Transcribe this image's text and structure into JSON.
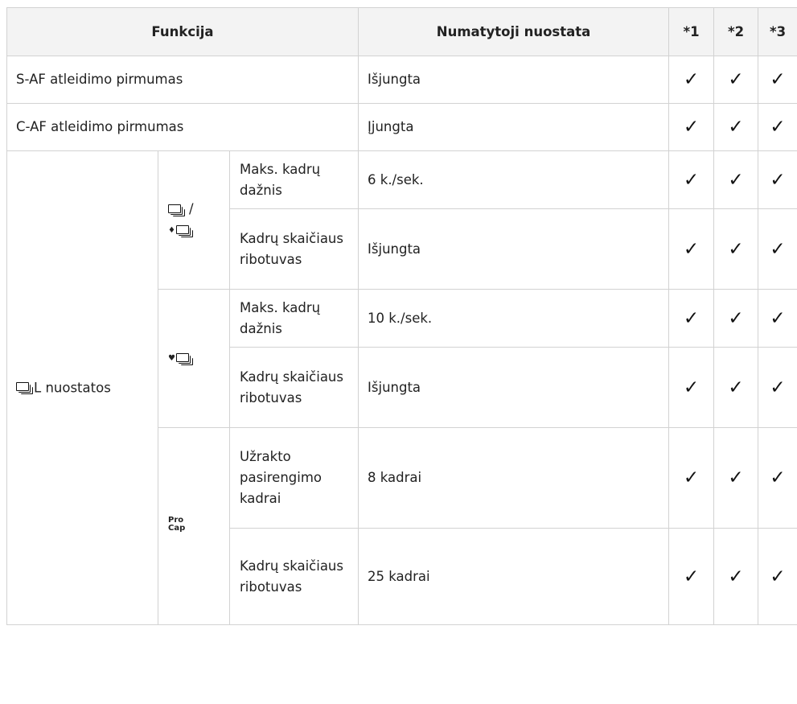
{
  "header": {
    "function": "Funkcija",
    "default": "Numatytoji nuostata",
    "col1": "*1",
    "col2": "*2",
    "col3": "*3"
  },
  "check_glyph": "✓",
  "rows": {
    "saf": {
      "label": "S-AF atleidimo pirmumas",
      "value": "Išjungta"
    },
    "caf": {
      "label": "C-AF atleidimo pirmumas",
      "value": "Įjungta"
    }
  },
  "group": {
    "label": "L nuostatos",
    "label_icon": "sequential-shooting-low-icon",
    "modes": {
      "m1": {
        "icons": "sequential-low-and-antishock-sequential-low-icons",
        "separator": "/",
        "antishock_mark": "♦",
        "items": [
          {
            "label": "Maks. kadrų dažnis",
            "value": "6 k./sek."
          },
          {
            "label": "Kadrų skaičiaus ribotuvas",
            "value": "Išjungta"
          }
        ]
      },
      "m2": {
        "icons": "silent-sequential-icon",
        "silent_mark": "♥",
        "items": [
          {
            "label": "Maks. kadrų dažnis",
            "value": "10 k./sek."
          },
          {
            "label": "Kadrų skaičiaus ribotuvas",
            "value": "Išjungta"
          }
        ]
      },
      "m3": {
        "icons": "pro-capture-icon",
        "text1": "Pro",
        "text2": "Cap",
        "items": [
          {
            "label": "Užrakto pasirengimo kadrai",
            "value": "8 kadrai"
          },
          {
            "label": "Kadrų skaičiaus ribotuvas",
            "value": "25 kadrai"
          }
        ]
      }
    }
  }
}
